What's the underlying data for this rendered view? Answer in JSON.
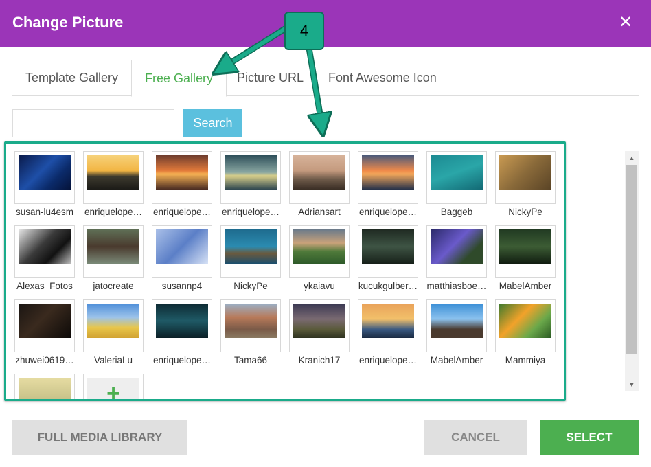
{
  "dialog": {
    "title": "Change Picture",
    "close_glyph": "✕"
  },
  "tabs": [
    {
      "label": "Template Gallery",
      "active": false
    },
    {
      "label": "Free Gallery",
      "active": true
    },
    {
      "label": "Picture URL",
      "active": false
    },
    {
      "label": "Font Awesome Icon",
      "active": false
    }
  ],
  "search": {
    "value": "",
    "placeholder": "",
    "button_label": "Search"
  },
  "gallery": {
    "items": [
      {
        "label": "susan-lu4esm",
        "bg": "linear-gradient(135deg,#0a1a4a,#1e4fa8 45%,#0b2b6b 70%,#05133a)"
      },
      {
        "label": "enriquelope…",
        "bg": "linear-gradient(180deg,#f6d27a,#f2b543 45%,#3d3a2e 62%,#1c1b17)"
      },
      {
        "label": "enriquelope…",
        "bg": "linear-gradient(180deg,#6e3d2e,#e27a3a 45%,#f6b153 55%,#4a2c22)"
      },
      {
        "label": "enriquelope…",
        "bg": "linear-gradient(180deg,#2e4f5a,#8aa7a2 50%,#d9cf8a 60%,#2f4750)"
      },
      {
        "label": "Adriansart",
        "bg": "linear-gradient(180deg,#d7b39a,#c49a7e 45%,#6e5a49 70%,#3a2e25)"
      },
      {
        "label": "enriquelope…",
        "bg": "linear-gradient(180deg,#4b5a7a,#f08a4a 45%,#f2a65a 55%,#26324a)"
      },
      {
        "label": "Baggeb",
        "bg": "linear-gradient(160deg,#1c8a92,#2aa6a8 50%,#136a75)"
      },
      {
        "label": "NickyPe",
        "bg": "linear-gradient(135deg,#c99a52,#8a6a3a 50%,#5a4426)"
      },
      {
        "label": "Alexas_Fotos",
        "bg": "linear-gradient(135deg,#e6e6e6,#3a3a3a 45%,#111 70%,#bbbbbb)"
      },
      {
        "label": "jatocreate",
        "bg": "linear-gradient(180deg,#5f6f56,#4a3a2e 50%,#7a8a78)"
      },
      {
        "label": "susannp4",
        "bg": "linear-gradient(135deg,#a9bfe8,#5b7fc7 50%,#d6e1f5)"
      },
      {
        "label": "NickyPe",
        "bg": "linear-gradient(180deg,#1e6b8e,#2b8bb0 50%,#6b5a3e 70%,#1b4f6e)"
      },
      {
        "label": "ykaiavu",
        "bg": "linear-gradient(180deg,#6a7a8a,#c9a27a 40%,#4f7a3a 65%,#2e5a2a)"
      },
      {
        "label": "kucukgulber…",
        "bg": "linear-gradient(180deg,#1f2a22,#3e5444 50%,#172019)"
      },
      {
        "label": "matthiasboe…",
        "bg": "linear-gradient(135deg,#2b2a6a,#6a5acb 45%,#2f4a2a 75%)"
      },
      {
        "label": "MabelAmber",
        "bg": "linear-gradient(180deg,#213a22,#3c5c34 50%,#101c10)"
      },
      {
        "label": "zhuwei0619…",
        "bg": "linear-gradient(135deg,#1a1512,#3a2a1e 45%,#0d0a08)"
      },
      {
        "label": "ValeriaLu",
        "bg": "linear-gradient(180deg,#4f8fd9,#9cc3ea 40%,#e8c64a 70%,#d1a232)"
      },
      {
        "label": "enriquelope…",
        "bg": "linear-gradient(180deg,#0d2a33,#1f5a66 50%,#0b1f26)"
      },
      {
        "label": "Tama66",
        "bg": "linear-gradient(180deg,#9bb0c6,#b87a5a 40%,#7a5a48 75%,#8a7a62)"
      },
      {
        "label": "Kranich17",
        "bg": "linear-gradient(180deg,#3a3852,#7a6a72 45%,#5a5a3a 75%,#2e3220)"
      },
      {
        "label": "enriquelope…",
        "bg": "linear-gradient(180deg,#e9a25a,#f2c06a 45%,#3a5a82 75%,#1a2a42)"
      },
      {
        "label": "MabelAmber",
        "bg": "linear-gradient(180deg,#3b8fd6,#8cc2ee 45%,#4a3a2e 75%)"
      },
      {
        "label": "Mammiya",
        "bg": "linear-gradient(135deg,#3e7a2e,#f2a22a 40%,#6aa84a 70%,#2a5a22)"
      },
      {
        "label": "",
        "bg": "linear-gradient(180deg,#e6dca2,#c9c38a 60%,#aaa57a)"
      }
    ],
    "add_tile": {
      "glyph": "+"
    }
  },
  "footer": {
    "media_label": "FULL MEDIA LIBRARY",
    "cancel_label": "CANCEL",
    "select_label": "SELECT"
  },
  "callout": {
    "number": "4"
  },
  "scrollbar": {
    "up_glyph": "▲",
    "down_glyph": "▼"
  },
  "colors": {
    "header": "#9b35b8",
    "accent_green": "#4caf50",
    "search_button": "#5bc0de",
    "callout_teal": "#1aab8a"
  }
}
